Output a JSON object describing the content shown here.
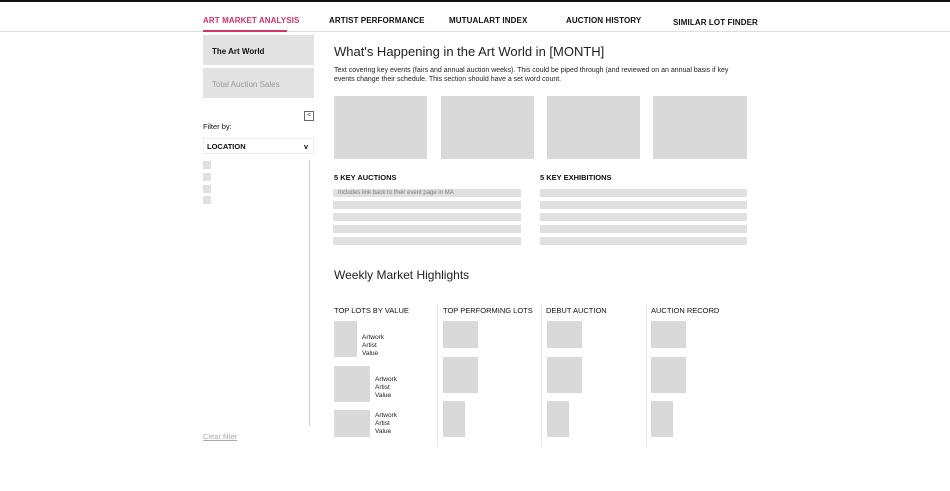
{
  "nav": {
    "tabs": [
      {
        "label": "ART MARKET ANALYSIS",
        "active": true
      },
      {
        "label": "ARTIST PERFORMANCE"
      },
      {
        "label": "MUTUALART INDEX"
      },
      {
        "label": "AUCTION HISTORY"
      },
      {
        "label": "SIMILAR LOT FINDER"
      }
    ]
  },
  "sidebar": {
    "items": [
      {
        "label": "The Art World",
        "active": true
      },
      {
        "label": "Total Auction Sales"
      }
    ],
    "collapse_icon": "<",
    "filter_label": "Filter by:",
    "filter_select": "LOCATION",
    "select_chevron": "v",
    "clear_filter": "Clear filter"
  },
  "main": {
    "title": "What's Happening in the Art World in [MONTH]",
    "description": "Text covering key events (fairs and annual auction weeks). This could be piped through (and reviewed on an annual basis if key events change their schedule. This section should have a set word count.",
    "key_auctions": {
      "title": "5 KEY AUCTIONS",
      "note": "Includes link back to their event page in MA"
    },
    "key_exhibitions": {
      "title": "5 KEY EXHIBITIONS"
    },
    "weekly_title": "Weekly Market Highlights",
    "columns": [
      "TOP LOTS BY VALUE",
      "TOP PERFORMING LOTS",
      "DEBUT AUCTION",
      "AUCTION RECORD"
    ],
    "lot_meta": {
      "artwork": "Artwork",
      "artist": "Artist",
      "value": "Value"
    }
  }
}
